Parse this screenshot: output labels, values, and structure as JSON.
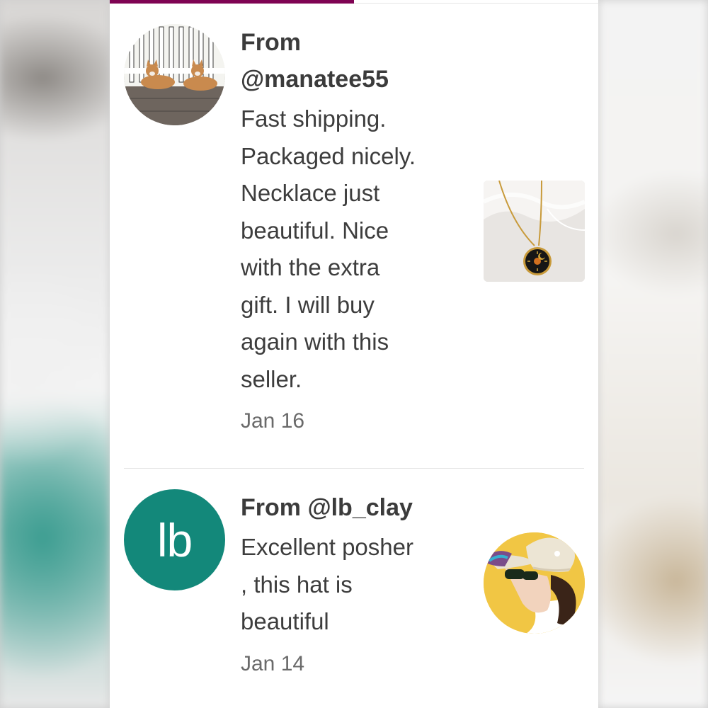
{
  "reviews": [
    {
      "from": "From @manatee55",
      "from_line1": "From",
      "from_line2": "@manatee55",
      "body_lines": [
        "Fast shipping.",
        "Packaged nicely.",
        "Necklace just",
        "beautiful. Nice",
        "with the extra",
        "gift. I will buy",
        "again with this",
        "seller."
      ],
      "date": "Jan 16",
      "avatar_type": "photo",
      "avatar_desc_icon": "corgi-dogs-photo",
      "item_icon": "necklace-pendant-photo"
    },
    {
      "from": "From @lb_clay",
      "body_lines": [
        "Excellent posher",
        ", this hat is",
        "beautiful"
      ],
      "date": "Jan 14",
      "avatar_type": "letter",
      "avatar_letter": "lb",
      "avatar_color": "#13887a",
      "item_icon": "sun-hat-photo"
    }
  ],
  "colors": {
    "tab_indicator": "#7f0353",
    "text": "#3b3b3b",
    "date": "#6a6a6a"
  }
}
